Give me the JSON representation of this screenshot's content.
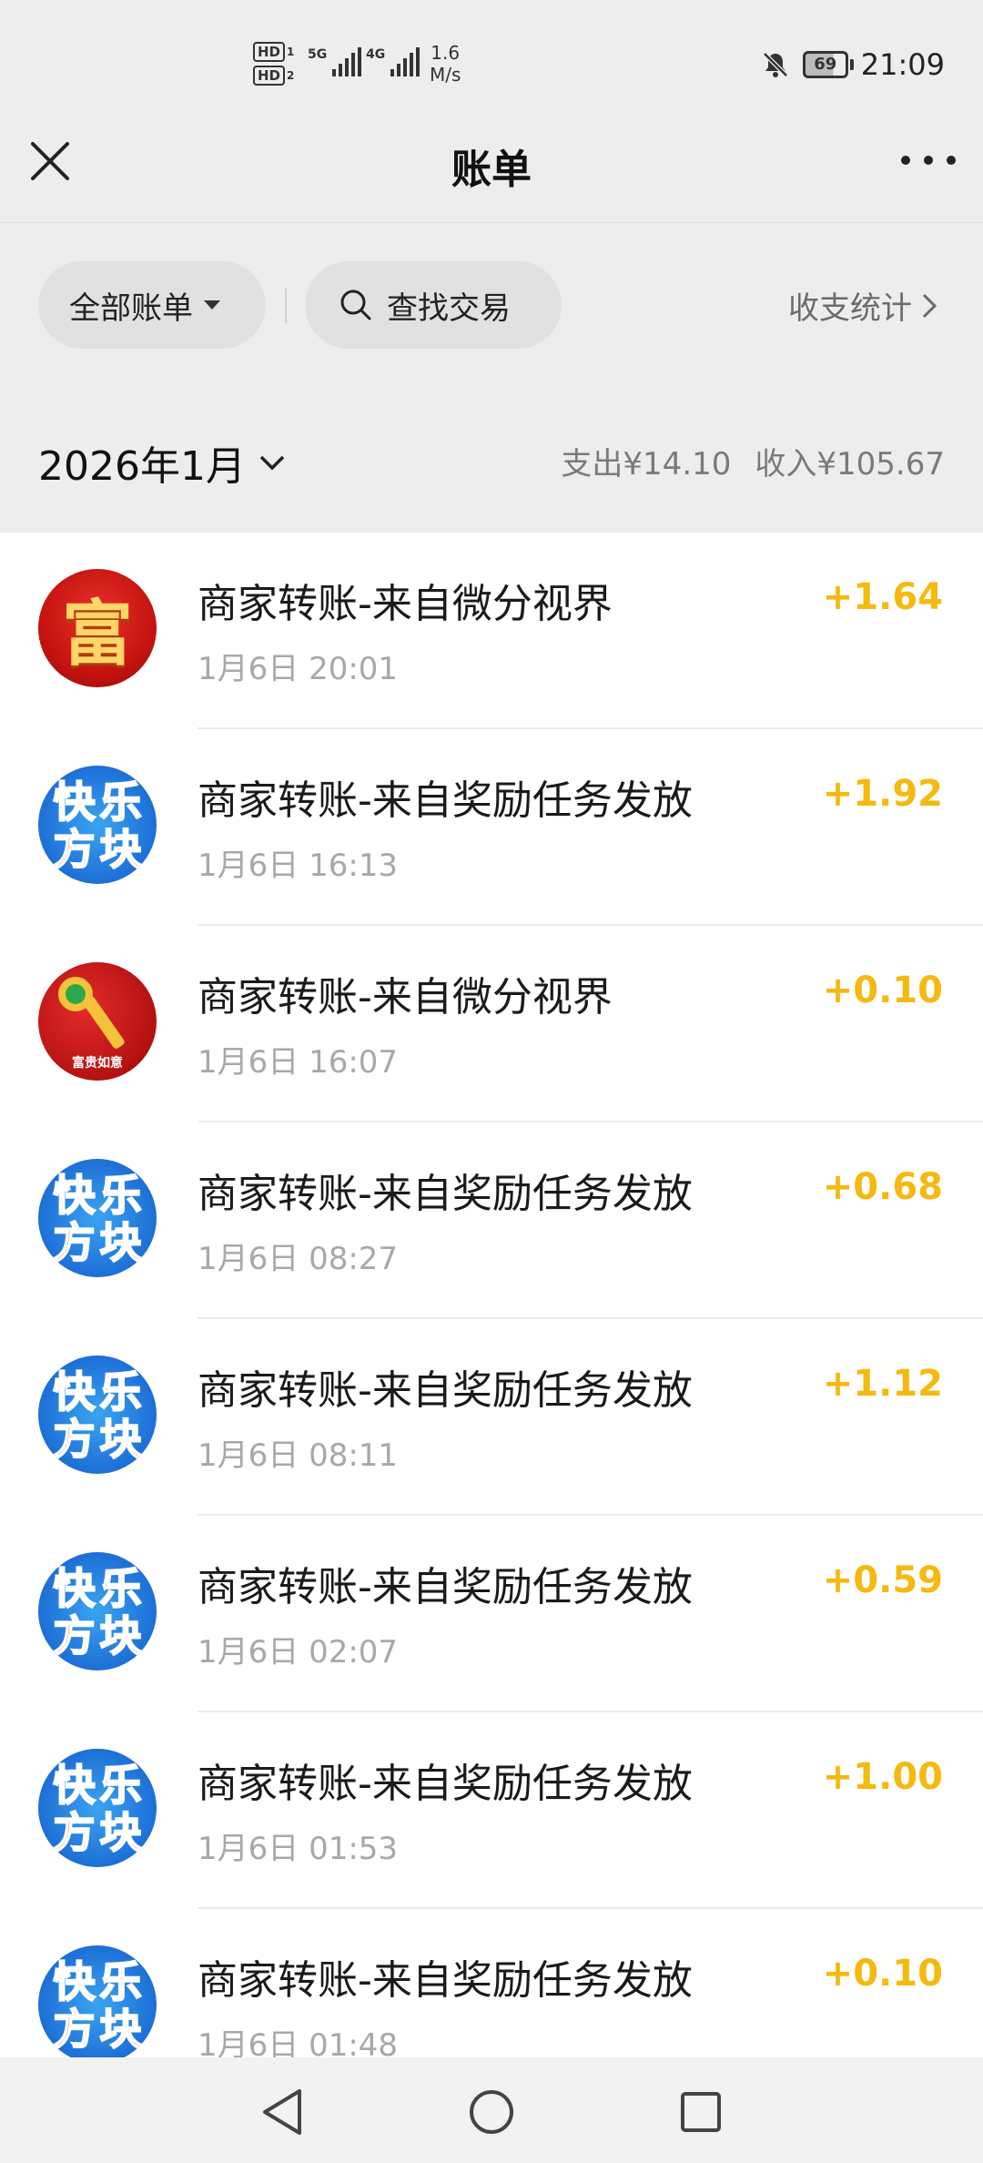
{
  "status_bar": {
    "sim1_label": "HD",
    "sim1_index": "1",
    "sim2_label": "HD",
    "sim2_index": "2",
    "network1": "5G",
    "network2": "4G",
    "speed_value": "1.6",
    "speed_unit": "M/s",
    "battery": "69",
    "time": "21:09",
    "icons": [
      "bell-mute-icon",
      "battery-icon"
    ]
  },
  "nav": {
    "title": "账单",
    "icons": [
      "close-icon",
      "more-icon"
    ]
  },
  "filters": {
    "all_bills": "全部账单",
    "search": "查找交易",
    "stats": "收支统计"
  },
  "month_header": {
    "month": "2026年1月",
    "expense": "支出¥14.10",
    "income": "收入¥105.67"
  },
  "transactions": [
    {
      "title": "商家转账-来自微分视界",
      "time": "1月6日 20:01",
      "amount": "+1.64",
      "avatar": "fu-avatar"
    },
    {
      "title": "商家转账-来自奖励任务发放",
      "time": "1月6日 16:13",
      "amount": "+1.92",
      "avatar": "klfk-avatar"
    },
    {
      "title": "商家转账-来自微分视界",
      "time": "1月6日 16:07",
      "amount": "+0.10",
      "avatar": "key-avatar"
    },
    {
      "title": "商家转账-来自奖励任务发放",
      "time": "1月6日 08:27",
      "amount": "+0.68",
      "avatar": "klfk-avatar"
    },
    {
      "title": "商家转账-来自奖励任务发放",
      "time": "1月6日 08:11",
      "amount": "+1.12",
      "avatar": "klfk-avatar"
    },
    {
      "title": "商家转账-来自奖励任务发放",
      "time": "1月6日 02:07",
      "amount": "+0.59",
      "avatar": "klfk-avatar"
    },
    {
      "title": "商家转账-来自奖励任务发放",
      "time": "1月6日 01:53",
      "amount": "+1.00",
      "avatar": "klfk-avatar"
    },
    {
      "title": "商家转账-来自奖励任务发放",
      "time": "1月6日 01:48",
      "amount": "+0.10",
      "avatar": "klfk-avatar"
    }
  ],
  "avatar_text": {
    "fu": "富",
    "klfk": [
      "快",
      "乐",
      "方",
      "块"
    ],
    "key_caption": "富贵如意"
  },
  "colors": {
    "background": "#ededed",
    "amount": "#f5b90f",
    "list_bg": "#ffffff"
  },
  "system_nav": {
    "icons": [
      "back-icon",
      "home-icon",
      "recents-icon"
    ]
  }
}
